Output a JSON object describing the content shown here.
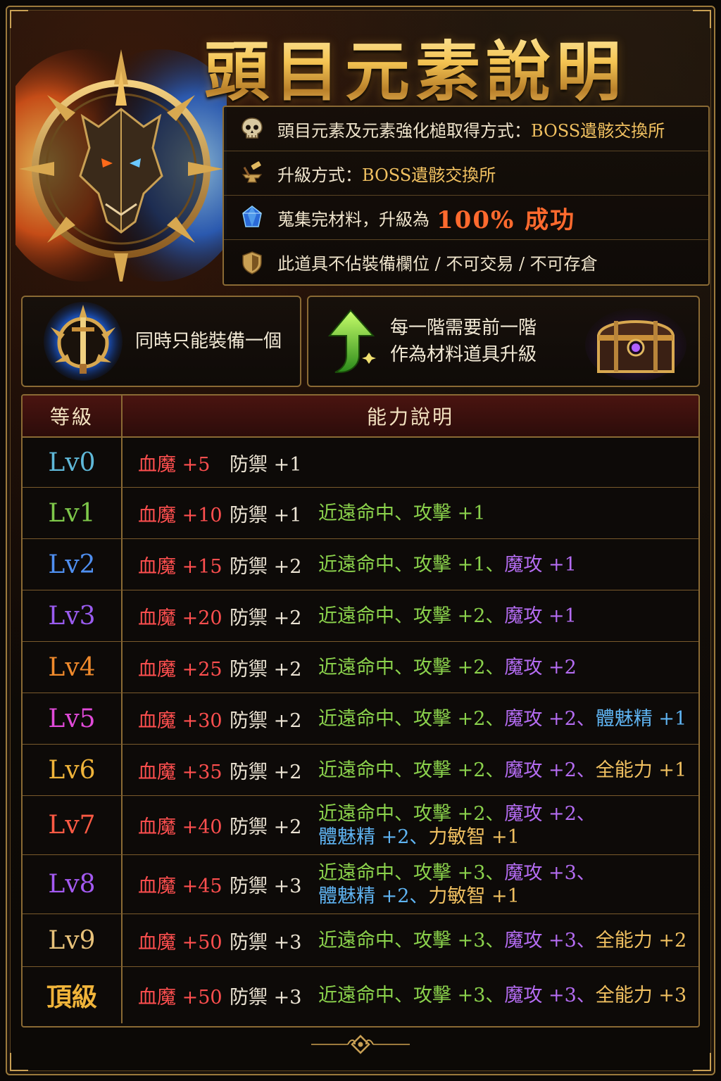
{
  "title": "頭目元素說明",
  "info": {
    "obtain_label": "頭目元素及元素強化槌取得方式：",
    "obtain_value": "BOSS遺骸交換所",
    "upgrade_label": "升級方式：",
    "upgrade_value": "BOSS遺骸交換所",
    "success_label": "蒐集完材料，升級為",
    "success_value": "100% 成功",
    "note": "此道具不佔裝備欄位 / 不可交易 / 不可存倉"
  },
  "features": {
    "equip_one": "同時只能裝備一個",
    "tier_line1": "每一階需要前一階",
    "tier_line2": "作為材料道具升級"
  },
  "table": {
    "header_level": "等級",
    "header_desc": "能力說明",
    "rows": [
      {
        "lv": "Lv0",
        "lv_color": "#5fb8d8",
        "hp": "血魔 +5",
        "def": "防禦 +1",
        "line1": [],
        "line2": []
      },
      {
        "lv": "Lv1",
        "lv_color": "#7ec84a",
        "hp": "血魔 +10",
        "def": "防禦 +1",
        "line1": [
          {
            "t": "近遠命中、攻擊 +1",
            "c": "green"
          }
        ],
        "line2": []
      },
      {
        "lv": "Lv2",
        "lv_color": "#4f8ff0",
        "hp": "血魔 +15",
        "def": "防禦 +2",
        "line1": [
          {
            "t": "近遠命中、攻擊 +1、",
            "c": "green"
          },
          {
            "t": "魔攻 +1",
            "c": "purple"
          }
        ],
        "line2": []
      },
      {
        "lv": "Lv3",
        "lv_color": "#9a5cf0",
        "hp": "血魔 +20",
        "def": "防禦 +2",
        "line1": [
          {
            "t": "近遠命中、攻擊 +2、",
            "c": "green"
          },
          {
            "t": "魔攻 +1",
            "c": "purple"
          }
        ],
        "line2": []
      },
      {
        "lv": "Lv4",
        "lv_color": "#f08a2c",
        "hp": "血魔 +25",
        "def": "防禦 +2",
        "line1": [
          {
            "t": "近遠命中、攻擊 +2、",
            "c": "green"
          },
          {
            "t": "魔攻 +2",
            "c": "purple"
          }
        ],
        "line2": []
      },
      {
        "lv": "Lv5",
        "lv_color": "#e04ad8",
        "hp": "血魔 +30",
        "def": "防禦 +2",
        "line1": [
          {
            "t": "近遠命中、攻擊 +2、",
            "c": "green"
          },
          {
            "t": "魔攻 +2、",
            "c": "purple"
          },
          {
            "t": "體魅精 +1",
            "c": "blue"
          }
        ],
        "line2": []
      },
      {
        "lv": "Lv6",
        "lv_color": "#f0b43a",
        "hp": "血魔 +35",
        "def": "防禦 +2",
        "line1": [
          {
            "t": "近遠命中、攻擊 +2、",
            "c": "green"
          },
          {
            "t": "魔攻 +2、",
            "c": "purple"
          },
          {
            "t": "全能力 +1",
            "c": "gold"
          }
        ],
        "line2": []
      },
      {
        "lv": "Lv7",
        "lv_color": "#ff5a44",
        "hp": "血魔 +40",
        "def": "防禦 +2",
        "line1": [
          {
            "t": "近遠命中、攻擊 +2、",
            "c": "green"
          },
          {
            "t": "魔攻 +2、",
            "c": "purple"
          }
        ],
        "line2": [
          {
            "t": "體魅精 +2、",
            "c": "blue"
          },
          {
            "t": "力敏智 +1",
            "c": "gold"
          }
        ]
      },
      {
        "lv": "Lv8",
        "lv_color": "#a45af2",
        "hp": "血魔 +45",
        "def": "防禦 +3",
        "line1": [
          {
            "t": "近遠命中、攻擊 +3、",
            "c": "green"
          },
          {
            "t": "魔攻 +3、",
            "c": "purple"
          }
        ],
        "line2": [
          {
            "t": "體魅精 +2、",
            "c": "blue"
          },
          {
            "t": "力敏智 +1",
            "c": "gold"
          }
        ]
      },
      {
        "lv": "Lv9",
        "lv_color": "#e8c27a",
        "hp": "血魔 +50",
        "def": "防禦 +3",
        "line1": [
          {
            "t": "近遠命中、攻擊 +3、",
            "c": "green"
          },
          {
            "t": "魔攻 +3、",
            "c": "purple"
          },
          {
            "t": "全能力 +2",
            "c": "gold"
          }
        ],
        "line2": []
      },
      {
        "lv": "頂級",
        "lv_color": "#f0b43a",
        "hp": "血魔 +50",
        "def": "防禦 +3",
        "line1": [
          {
            "t": "近遠命中、攻擊 +3、",
            "c": "green"
          },
          {
            "t": "魔攻 +3、",
            "c": "purple"
          },
          {
            "t": "全能力 +3",
            "c": "gold"
          }
        ],
        "line2": []
      }
    ]
  },
  "colors": {
    "accent_gold": "#f0c060",
    "success": "#ff6a2e",
    "hp": "#ff4f4f",
    "border": "#8a6a34"
  },
  "icons": [
    "dragon-emblem-icon",
    "skull-icon",
    "anvil-hammer-icon",
    "crystal-icon",
    "shield-icon",
    "sword-emblem-icon",
    "up-arrow-icon",
    "treasure-chest-icon"
  ]
}
